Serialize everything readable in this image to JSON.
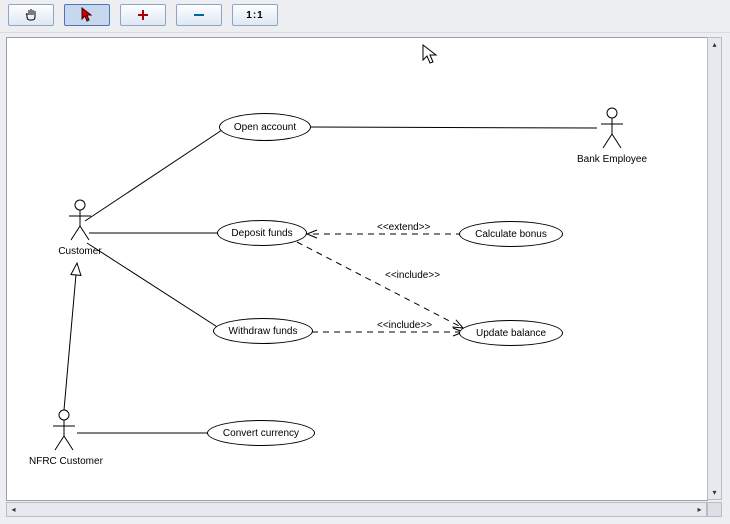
{
  "toolbar": {
    "buttons": [
      {
        "name": "hand-tool",
        "icon": "hand",
        "selected": false
      },
      {
        "name": "select-tool",
        "icon": "pointer",
        "selected": true
      },
      {
        "name": "zoom-in-tool",
        "icon": "plus",
        "selected": false
      },
      {
        "name": "zoom-out-tool",
        "icon": "minus",
        "selected": false
      },
      {
        "name": "zoom-reset",
        "icon": "ratio",
        "selected": false,
        "label": "1:1"
      }
    ]
  },
  "diagram": {
    "actors": {
      "customer": {
        "label": "Customer"
      },
      "nfrc_customer": {
        "label": "NFRC Customer"
      },
      "bank_employee": {
        "label": "Bank Employee"
      }
    },
    "usecases": {
      "open_account": {
        "label": "Open account"
      },
      "deposit_funds": {
        "label": "Deposit funds"
      },
      "withdraw_funds": {
        "label": "Withdraw funds"
      },
      "convert_currency": {
        "label": "Convert currency"
      },
      "calculate_bonus": {
        "label": "Calculate bonus"
      },
      "update_balance": {
        "label": "Update balance"
      }
    },
    "relations": {
      "extend": {
        "label": "<<extend>>"
      },
      "include1": {
        "label": "<<include>>"
      },
      "include2": {
        "label": "<<include>>"
      }
    }
  }
}
